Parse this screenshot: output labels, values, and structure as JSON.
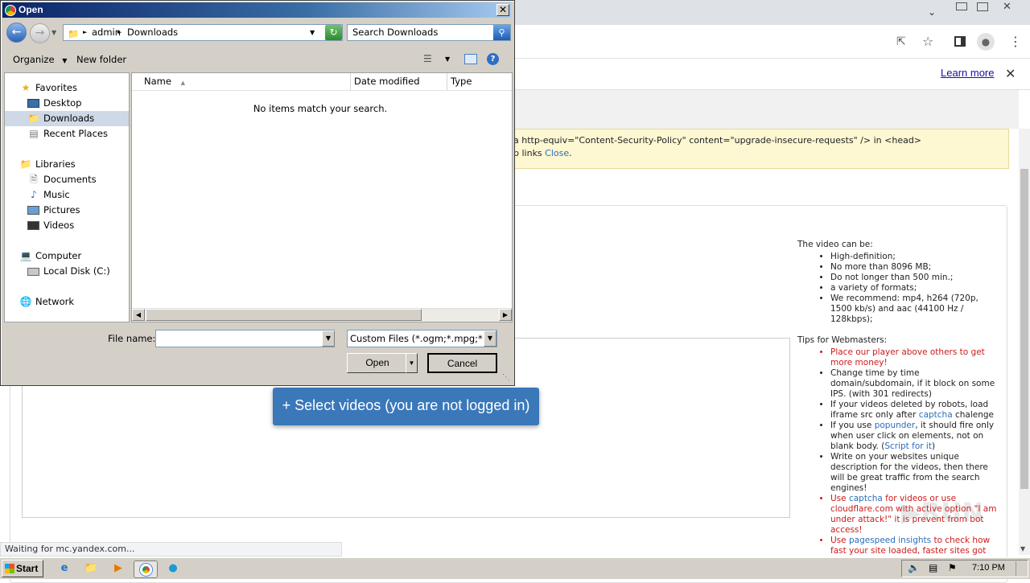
{
  "browser": {
    "learn_more": "Learn more",
    "csp_line1": "a http-equiv=\"Content-Security-Policy\" content=\"upgrade-insecure-requests\" /> in <head>",
    "csp_line2_prefix": "p links ",
    "csp_close": "Close"
  },
  "page": {
    "select_videos": "+ Select videos (you are not logged in)",
    "video_heading": "The video can be:",
    "video_points": [
      "High-definition;",
      "No more than 8096 MB;",
      "Do not longer than 500 min.;",
      "a variety of formats;",
      "We recommend: mp4, h264 (720p, 1500 kb/s) and aac (44100 Hz / 128kbps);"
    ],
    "tips_heading": "Tips for Webmasters:",
    "tip1": "Place our player above others to get more money!",
    "tip2": "Change time by time domain/subdomain, if it block on some IPS. (with 301 redirects)",
    "tip3_a": "If your videos deleted by robots, load iframe src only after ",
    "tip3_link": "captcha",
    "tip3_b": " chalenge",
    "tip4_a": "If you use ",
    "tip4_link": "popunder",
    "tip4_b": ", it should fire only when user click on elements, not on blank body. (",
    "tip4_link2": "Script for it",
    "tip4_c": ")",
    "tip5": "Write on your websites unique description for the videos, then there will be great traffic from the search engines!",
    "tip6_a": "Use ",
    "tip6_link": "captcha",
    "tip6_b": " for videos or use cloudflare.com with active option \"I am under attack!\" it is prevent from bot access!",
    "tip7_a": "Use ",
    "tip7_link": "pagespeed insights",
    "tip7_b": " to check how fast your site loaded, faster sites got"
  },
  "status": "Waiting for mc.yandex.com...",
  "taskbar": {
    "start": "Start",
    "clock": "7:10 PM"
  },
  "dialog": {
    "title": "Open",
    "path": [
      "admin",
      "Downloads"
    ],
    "search_placeholder": "Search Downloads",
    "organize": "Organize",
    "new_folder": "New folder",
    "nav": {
      "favorites": "Favorites",
      "desktop": "Desktop",
      "downloads": "Downloads",
      "recent": "Recent Places",
      "libraries": "Libraries",
      "documents": "Documents",
      "music": "Music",
      "pictures": "Pictures",
      "videos": "Videos",
      "computer": "Computer",
      "local_disk": "Local Disk (C:)",
      "network": "Network"
    },
    "columns": [
      "Name",
      "Date modified",
      "Type"
    ],
    "empty_msg": "No items match your search.",
    "file_name_label": "File name:",
    "file_name_value": "",
    "file_type": "Custom Files (*.ogm;*.mpg;*.w",
    "open": "Open",
    "cancel": "Cancel"
  }
}
